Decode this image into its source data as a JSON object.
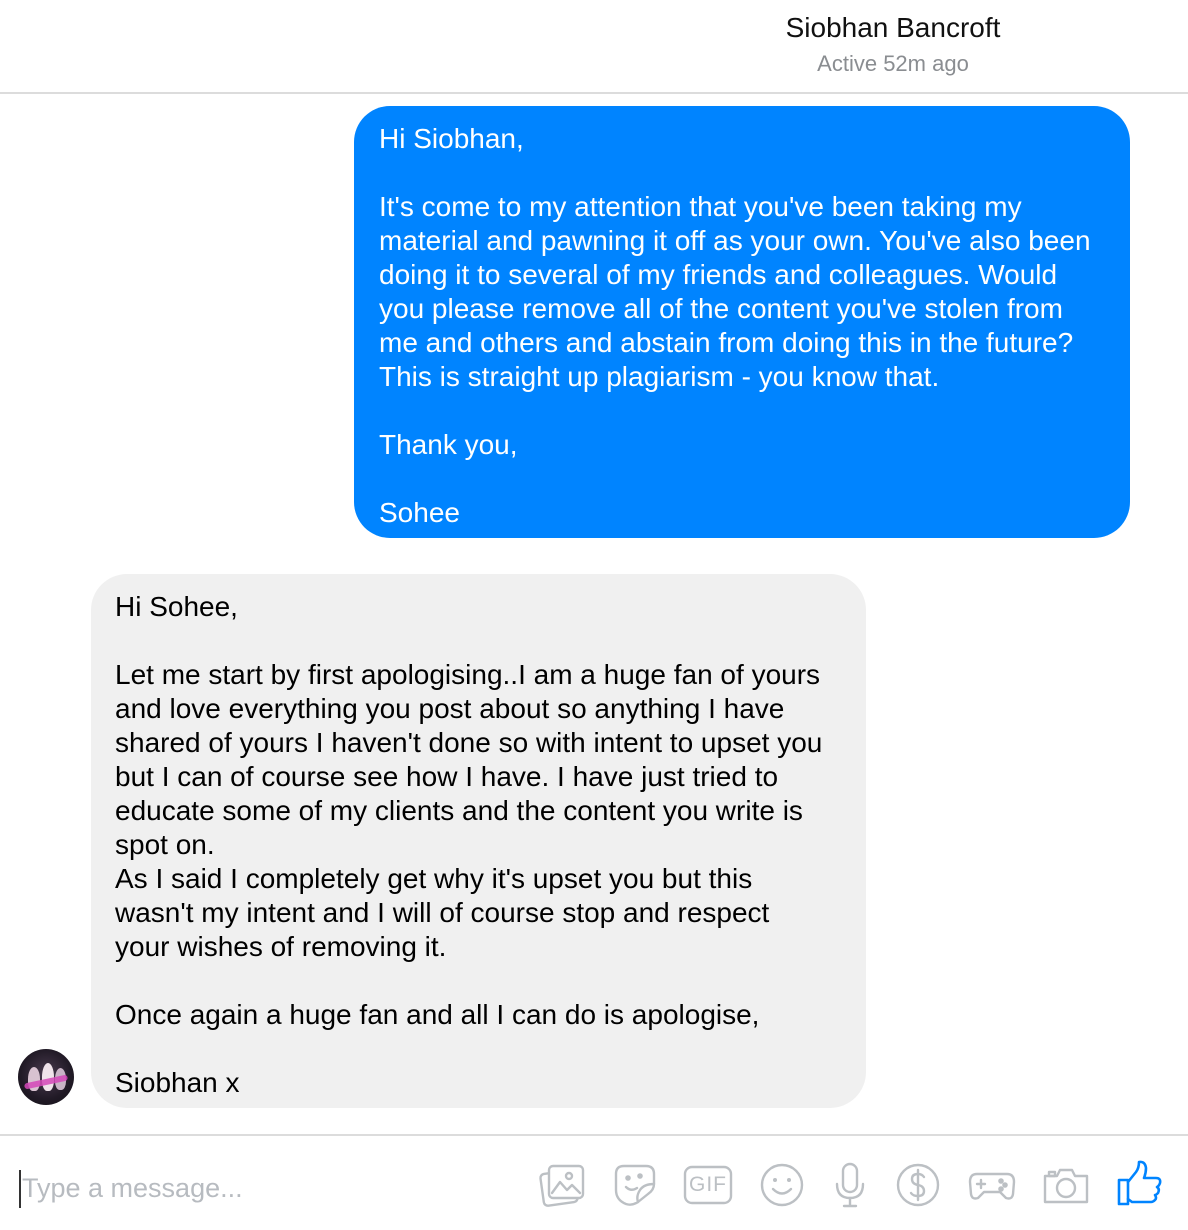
{
  "header": {
    "contact_name": "Siobhan Bancroft",
    "status": "Active 52m ago"
  },
  "messages": [
    {
      "direction": "outgoing",
      "text": "Hi Siobhan,\n\nIt's come to my attention that you've been taking my\nmaterial and pawning it off as your own. You've also been\ndoing it to several of my friends and colleagues. Would\nyou please remove all of the content you've stolen from\nme and others and abstain from doing this in the future?\nThis is straight up plagiarism - you know that.\n\nThank you,\n\nSohee"
    },
    {
      "direction": "incoming",
      "text": "Hi Sohee,\n\nLet me start by first apologising..I am a huge fan of yours\nand love everything you post about so anything I have\nshared of yours I haven't done so with intent to upset you\nbut I can of course see how I have. I have just tried to\neducate some of my clients and the content you write is\nspot on.\nAs I said I completely get why it's upset you but this\nwasn't my intent and I will of course stop and respect\nyour wishes of removing it.\n\nOnce again a huge fan and all I can do is apologise,\n\nSiobhan x"
    }
  ],
  "composer": {
    "placeholder": "Type a message...",
    "gif_label": "GIF",
    "icons": [
      "image-icon",
      "sticker-icon",
      "gif-icon",
      "emoji-icon",
      "microphone-icon",
      "payment-icon",
      "game-icon",
      "camera-icon",
      "like-icon"
    ]
  },
  "colors": {
    "outgoing_bubble": "#0084ff",
    "incoming_bubble": "#f0f0f0",
    "like_icon": "#0084ff",
    "toolbar_icon": "#bcc0c4"
  }
}
